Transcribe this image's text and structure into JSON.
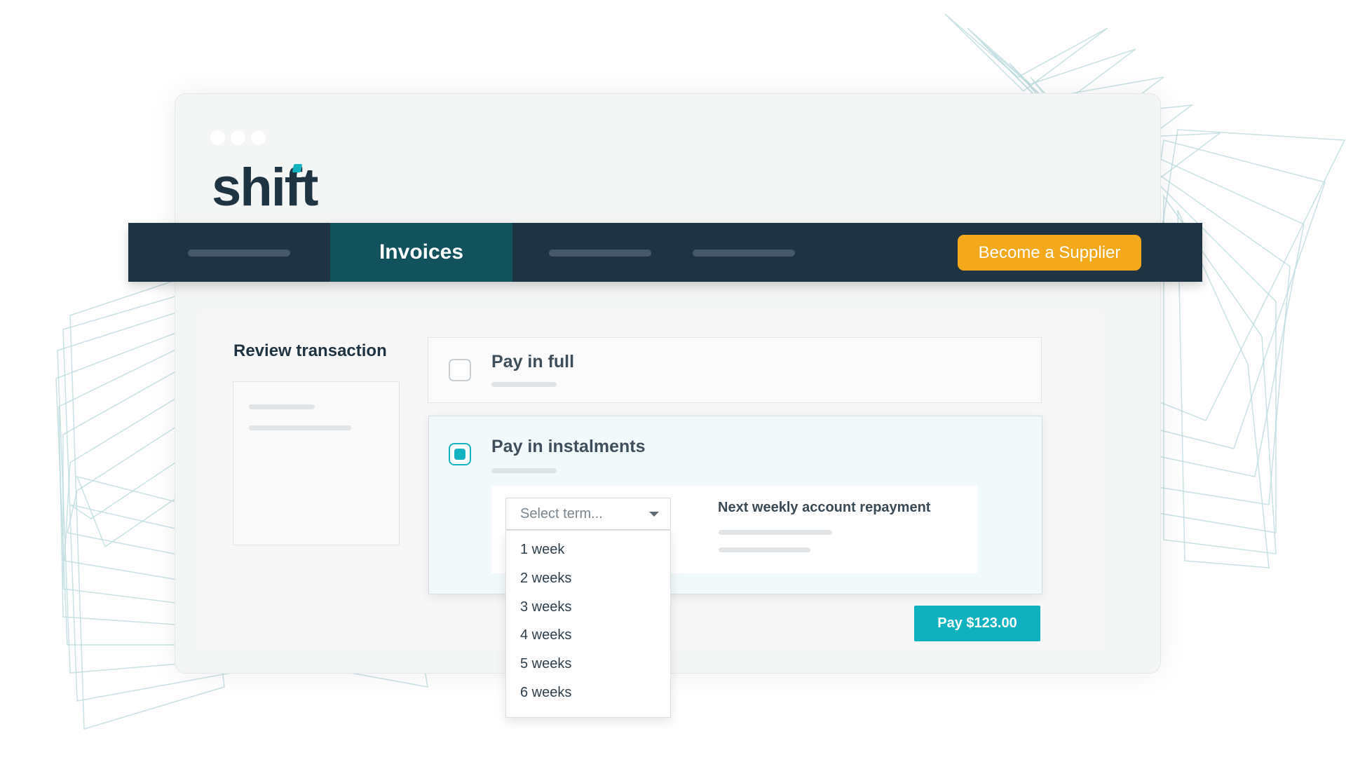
{
  "app": {
    "logo": "shift"
  },
  "nav": {
    "active_tab": "Invoices",
    "supplier_button": "Become a Supplier"
  },
  "review": {
    "title": "Review transaction"
  },
  "options": {
    "full": {
      "label": "Pay in full",
      "selected": false
    },
    "instalments": {
      "label": "Pay in instalments",
      "selected": true
    }
  },
  "term_select": {
    "placeholder": "Select term...",
    "options": [
      "1 week",
      "2 weeks",
      "3 weeks",
      "4 weeks",
      "5 weeks",
      "6 weeks"
    ]
  },
  "repayment": {
    "title": "Next weekly account repayment"
  },
  "pay_button": "Pay $123.00",
  "colors": {
    "navy": "#1f3442",
    "teal": "#14b2bf",
    "active_tab": "#12525d",
    "supplier": "#f4a81b"
  }
}
